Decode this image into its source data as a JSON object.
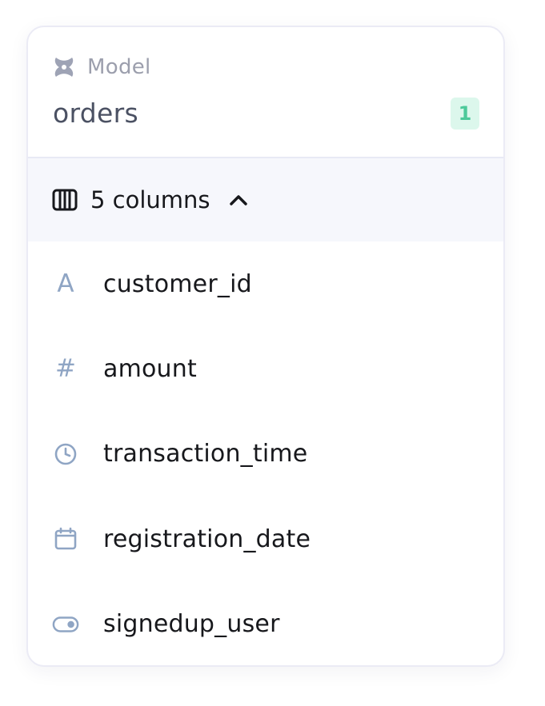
{
  "model": {
    "type_label": "Model",
    "name": "orders",
    "badge_count": "1",
    "icon": "model-icon"
  },
  "columns": {
    "summary_label": "5 columns",
    "expanded": true,
    "items": [
      {
        "name": "customer_id",
        "type_icon": "text-type-icon",
        "glyph": "A"
      },
      {
        "name": "amount",
        "type_icon": "number-type-icon",
        "glyph": "#"
      },
      {
        "name": "transaction_time",
        "type_icon": "clock-icon"
      },
      {
        "name": "registration_date",
        "type_icon": "calendar-icon"
      },
      {
        "name": "signedup_user",
        "type_icon": "toggle-icon"
      }
    ]
  },
  "colors": {
    "badge_bg": "#dcf7ec",
    "badge_text": "#4cc99a",
    "icon": "#8fa5c4",
    "header_bg": "#f6f7fc"
  }
}
